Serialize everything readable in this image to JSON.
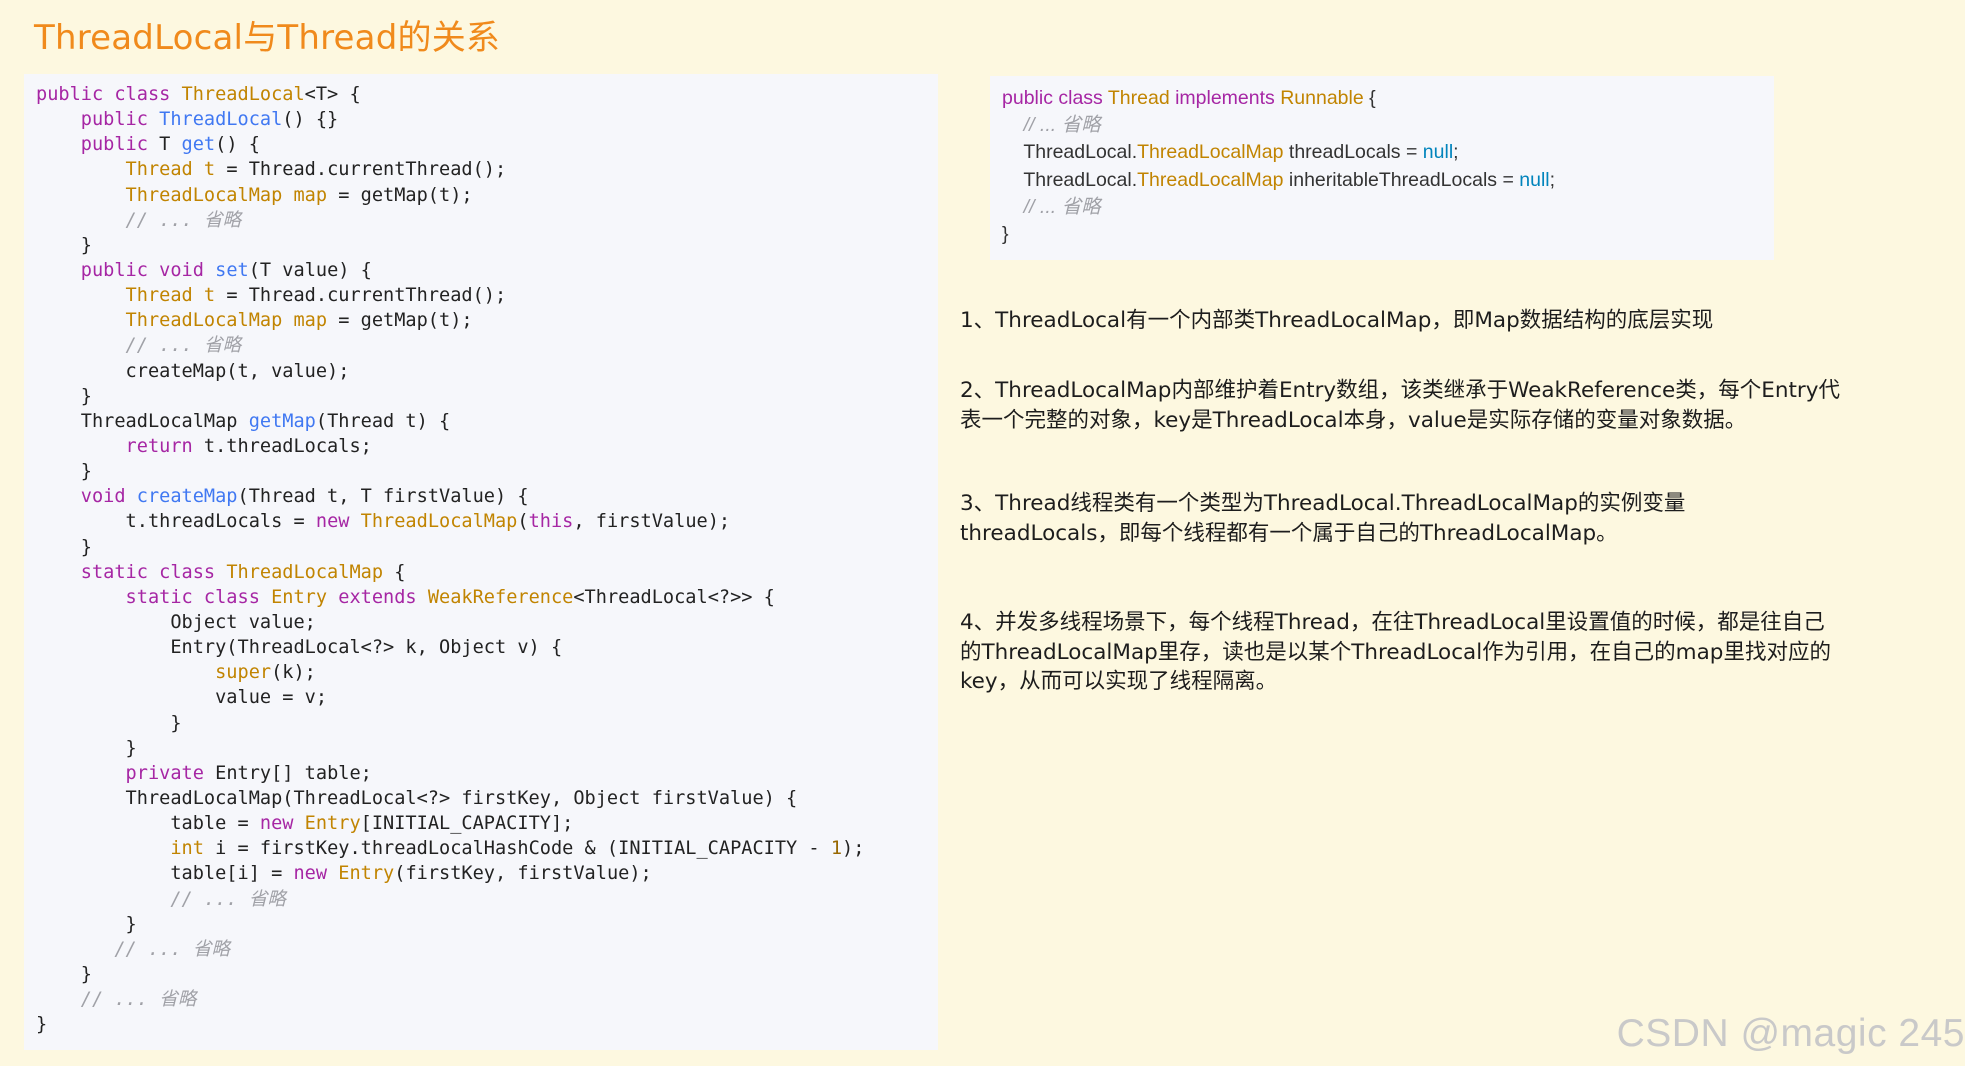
{
  "title": "ThreadLocal与Thread的关系",
  "left_code": [
    [
      {
        "t": "public class ",
        "c": "k"
      },
      {
        "t": "ThreadLocal",
        "c": "t"
      },
      {
        "t": "<T> {",
        "c": "p"
      }
    ],
    [
      {
        "t": "    public ",
        "c": "k"
      },
      {
        "t": "ThreadLocal",
        "c": "f"
      },
      {
        "t": "() {}",
        "c": "p"
      }
    ],
    [
      {
        "t": "    public ",
        "c": "k"
      },
      {
        "t": "T ",
        "c": "p"
      },
      {
        "t": "get",
        "c": "f"
      },
      {
        "t": "() {",
        "c": "p"
      }
    ],
    [
      {
        "t": "        Thread t",
        "c": "t"
      },
      {
        "t": " = Thread.currentThread();",
        "c": "p"
      }
    ],
    [
      {
        "t": "        ThreadLocalMap map",
        "c": "t"
      },
      {
        "t": " = getMap(t);",
        "c": "p"
      }
    ],
    [
      {
        "t": "        // ... 省略",
        "c": "c"
      }
    ],
    [
      {
        "t": "    }",
        "c": "p"
      }
    ],
    [
      {
        "t": "    public void ",
        "c": "k"
      },
      {
        "t": "set",
        "c": "f"
      },
      {
        "t": "(T value) {",
        "c": "p"
      }
    ],
    [
      {
        "t": "        Thread t",
        "c": "t"
      },
      {
        "t": " = Thread.currentThread();",
        "c": "p"
      }
    ],
    [
      {
        "t": "        ThreadLocalMap map",
        "c": "t"
      },
      {
        "t": " = getMap(t);",
        "c": "p"
      }
    ],
    [
      {
        "t": "        // ... 省略",
        "c": "c"
      }
    ],
    [
      {
        "t": "        createMap(t, value);",
        "c": "p"
      }
    ],
    [
      {
        "t": "    }",
        "c": "p"
      }
    ],
    [
      {
        "t": "    ThreadLocalMap ",
        "c": "p"
      },
      {
        "t": "getMap",
        "c": "f"
      },
      {
        "t": "(Thread t) {",
        "c": "p"
      }
    ],
    [
      {
        "t": "        return ",
        "c": "k"
      },
      {
        "t": "t.threadLocals;",
        "c": "p"
      }
    ],
    [
      {
        "t": "    }",
        "c": "p"
      }
    ],
    [
      {
        "t": "    void ",
        "c": "k"
      },
      {
        "t": "createMap",
        "c": "f"
      },
      {
        "t": "(Thread t, T firstValue) {",
        "c": "p"
      }
    ],
    [
      {
        "t": "        t.threadLocals = ",
        "c": "p"
      },
      {
        "t": "new ",
        "c": "k"
      },
      {
        "t": "ThreadLocalMap",
        "c": "t"
      },
      {
        "t": "(",
        "c": "p"
      },
      {
        "t": "this",
        "c": "k"
      },
      {
        "t": ", firstValue);",
        "c": "p"
      }
    ],
    [
      {
        "t": "    }",
        "c": "p"
      }
    ],
    [
      {
        "t": "    static class ",
        "c": "k"
      },
      {
        "t": "ThreadLocalMap",
        "c": "t"
      },
      {
        "t": " {",
        "c": "p"
      }
    ],
    [
      {
        "t": "        static class ",
        "c": "k"
      },
      {
        "t": "Entry ",
        "c": "t"
      },
      {
        "t": "extends ",
        "c": "k"
      },
      {
        "t": "WeakReference",
        "c": "t"
      },
      {
        "t": "<ThreadLocal<?>> {",
        "c": "p"
      }
    ],
    [
      {
        "t": "            Object value;",
        "c": "p"
      }
    ],
    [
      {
        "t": "            Entry(ThreadLocal<?> k, Object v) {",
        "c": "p"
      }
    ],
    [
      {
        "t": "                super",
        "c": "t"
      },
      {
        "t": "(k);",
        "c": "p"
      }
    ],
    [
      {
        "t": "                value = v;",
        "c": "p"
      }
    ],
    [
      {
        "t": "            }",
        "c": "p"
      }
    ],
    [
      {
        "t": "        }",
        "c": "p"
      }
    ],
    [
      {
        "t": "        private ",
        "c": "k"
      },
      {
        "t": "Entry[] table;",
        "c": "p"
      }
    ],
    [
      {
        "t": "        ThreadLocalMap(ThreadLocal<?> firstKey, Object firstValue) {",
        "c": "p"
      }
    ],
    [
      {
        "t": "            table = ",
        "c": "p"
      },
      {
        "t": "new ",
        "c": "k"
      },
      {
        "t": "Entry",
        "c": "t"
      },
      {
        "t": "[INITIAL_CAPACITY];",
        "c": "p"
      }
    ],
    [
      {
        "t": "            int ",
        "c": "t"
      },
      {
        "t": "i",
        "c": "p"
      },
      {
        "t": " = firstKey.threadLocalHashCode & (INITIAL_CAPACITY - ",
        "c": "p"
      },
      {
        "t": "1",
        "c": "n"
      },
      {
        "t": ");",
        "c": "p"
      }
    ],
    [
      {
        "t": "            table[i] = ",
        "c": "p"
      },
      {
        "t": "new ",
        "c": "k"
      },
      {
        "t": "Entry",
        "c": "t"
      },
      {
        "t": "(firstKey, firstValue);",
        "c": "p"
      }
    ],
    [
      {
        "t": "            // ... 省略",
        "c": "c"
      }
    ],
    [
      {
        "t": "        }",
        "c": "p"
      }
    ],
    [
      {
        "t": "       // ... 省略",
        "c": "c"
      }
    ],
    [
      {
        "t": "    }",
        "c": "p"
      }
    ],
    [
      {
        "t": "    // ... 省略",
        "c": "c"
      }
    ],
    [
      {
        "t": "}",
        "c": "p"
      }
    ]
  ],
  "right_code": [
    [
      {
        "t": "public class ",
        "c": "k"
      },
      {
        "t": "Thread ",
        "c": "t"
      },
      {
        "t": "implements ",
        "c": "k"
      },
      {
        "t": "Runnable",
        "c": "t"
      },
      {
        "t": " {",
        "c": "p"
      }
    ],
    [
      {
        "t": "    // ... 省略",
        "c": "c"
      }
    ],
    [
      {
        "t": "    ThreadLocal.",
        "c": "p"
      },
      {
        "t": "ThreadLocalMap",
        "c": "t"
      },
      {
        "t": " threadLocals = ",
        "c": "p"
      },
      {
        "t": "null",
        "c": "v"
      },
      {
        "t": ";",
        "c": "p"
      }
    ],
    [
      {
        "t": "    ThreadLocal.",
        "c": "p"
      },
      {
        "t": "ThreadLocalMap",
        "c": "t"
      },
      {
        "t": " inheritableThreadLocals = ",
        "c": "p"
      },
      {
        "t": "null",
        "c": "v"
      },
      {
        "t": ";",
        "c": "p"
      }
    ],
    [
      {
        "t": "    // ... 省略",
        "c": "c"
      }
    ],
    [
      {
        "t": "}",
        "c": "p"
      }
    ]
  ],
  "notes": {
    "n1": "1、ThreadLocal有一个内部类ThreadLocalMap，即Map数据结构的底层实现",
    "n2": "2、ThreadLocalMap内部维护着Entry数组，该类继承于WeakReference类，每个Entry代表一个完整的对象，key是ThreadLocal本身，value是实际存储的变量对象数据。",
    "n3": "3、Thread线程类有一个类型为ThreadLocal.ThreadLocalMap的实例变量threadLocals，即每个线程都有一个属于自己的ThreadLocalMap。",
    "n4": "4、并发多线程场景下，每个线程Thread，在往ThreadLocal里设置值的时候，都是往自己的ThreadLocalMap里存，读也是以某个ThreadLocal作为引用，在自己的map里找对应的key，从而可以实现了线程隔离。"
  },
  "watermark": "CSDN @magic 245",
  "colors": {
    "background": "#fdf8e0",
    "title": "#f08a1c",
    "keyword": "#a626a4",
    "type": "#c18401",
    "function": "#4078f2",
    "comment": "#a0a1a7",
    "literal": "#0184bc"
  }
}
